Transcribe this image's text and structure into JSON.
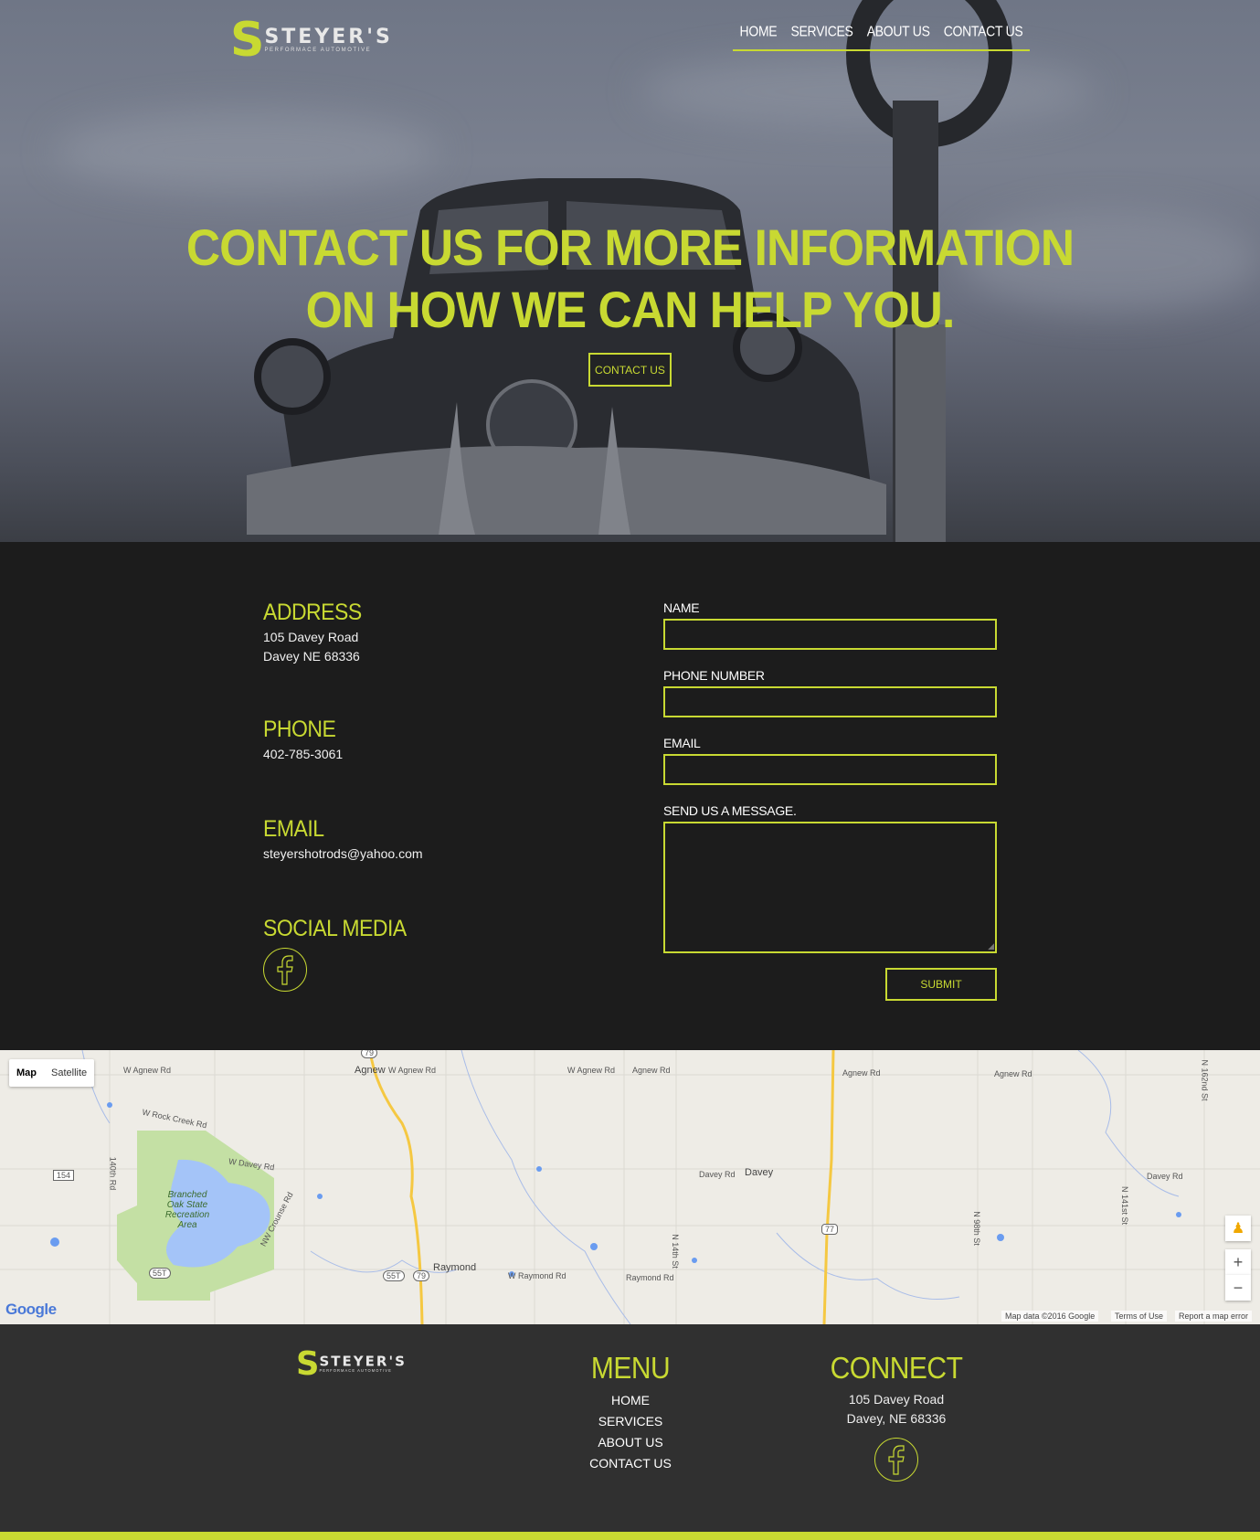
{
  "brand": {
    "s": "S",
    "name": "STEYER'S",
    "tagline": "PERFORMACE AUTOMOTIVE"
  },
  "nav": {
    "items": [
      "HOME",
      "SERVICES",
      "ABOUT US",
      "CONTACT US"
    ]
  },
  "hero": {
    "line1": "CONTACT US FOR MORE INFORMATION",
    "line2": "ON HOW WE CAN HELP YOU.",
    "button": "CONTACT US"
  },
  "contact": {
    "address_heading": "ADDRESS",
    "address_line1": "105 Davey Road",
    "address_line2": "Davey NE 68336",
    "phone_heading": "PHONE",
    "phone": "402-785-3061",
    "email_heading": "EMAIL",
    "email": "steyershotrods@yahoo.com",
    "social_heading": "SOCIAL MEDIA",
    "social_icon": "facebook-icon"
  },
  "form": {
    "name_label": "NAME",
    "phone_label": "PHONE NUMBER",
    "email_label": "EMAIL",
    "message_label": "SEND US A MESSAGE.",
    "submit": "SUBMIT"
  },
  "map": {
    "type_map": "Map",
    "type_satellite": "Satellite",
    "towns": [
      "Agnew",
      "Davey",
      "Raymond"
    ],
    "park": "Branched Oak State Recreation Area",
    "roads": [
      "W Agnew Rd",
      "W Agnew Rd",
      "W Agnew Rd",
      "Agnew Rd",
      "Agnew Rd",
      "Agnew Rd",
      "W Rock Creek Rd",
      "W Davey Rd",
      "Davey Rd",
      "Davey Rd",
      "NW Crounse Rd",
      "140th Rd",
      "W Raymond Rd",
      "Raymond Rd",
      "N 14th St",
      "N 98th St",
      "N 141st St",
      "N 162nd St"
    ],
    "shields": [
      "79",
      "154",
      "55T",
      "55T",
      "79",
      "77"
    ],
    "google": "Google",
    "map_data": "Map data ©2016 Google",
    "terms": "Terms of Use",
    "report": "Report a map error",
    "zoom_in": "+",
    "zoom_out": "−"
  },
  "footer": {
    "menu_heading": "MENU",
    "menu": [
      "HOME",
      "SERVICES",
      "ABOUT US",
      "CONTACT US"
    ],
    "connect_heading": "CONNECT",
    "address_line1": "105 Davey Road",
    "address_line2": "Davey, NE 68336"
  },
  "colors": {
    "accent": "#c8d932",
    "dark": "#1c1c1c",
    "footer": "#303030"
  }
}
